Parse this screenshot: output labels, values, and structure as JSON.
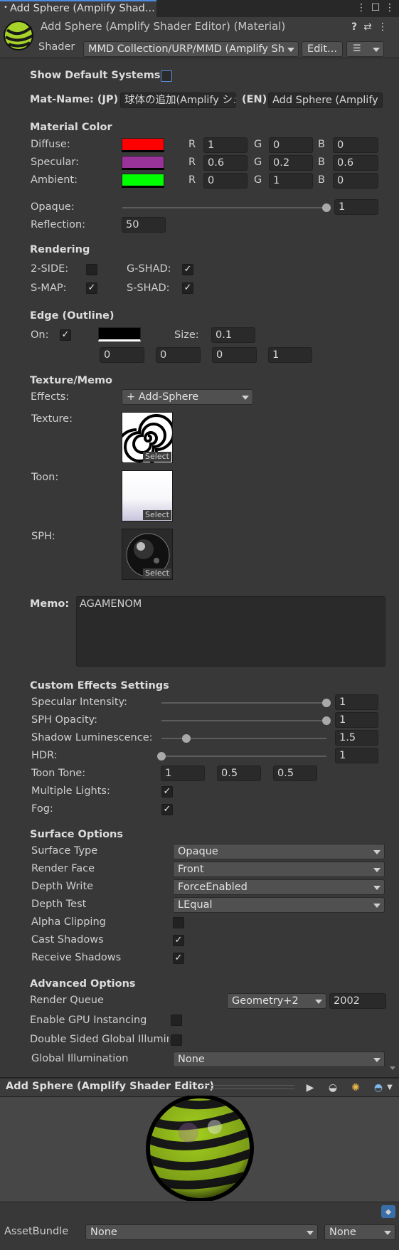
{
  "tab": {
    "title": "Add Sphere (Amplify Shad..."
  },
  "header": {
    "title": "Add Sphere (Amplify Shader Editor) (Material)",
    "shader_label": "Shader",
    "shader_value": "MMD Collection/URP/MMD (Amplify Sh",
    "edit_label": "Edit..."
  },
  "general": {
    "show_default_label": "Show Default Systems:",
    "matname_label": "Mat-Name: (JP)",
    "matname_jp": "球体の追加(Amplify シェ",
    "en_label": "(EN)",
    "matname_en": "Add Sphere (Amplify S"
  },
  "material_color": {
    "title": "Material Color",
    "rows": [
      {
        "label": "Diffuse:",
        "color": "#ff0000",
        "r": "1",
        "g": "0",
        "b": "0"
      },
      {
        "label": "Specular:",
        "color": "#993399",
        "r": "0.6",
        "g": "0.2",
        "b": "0.6"
      },
      {
        "label": "Ambient:",
        "color": "#00ff00",
        "r": "0",
        "g": "1",
        "b": "0"
      }
    ],
    "r_label": "R",
    "g_label": "G",
    "b_label": "B",
    "opaque_label": "Opaque:",
    "opaque_value": "1",
    "opaque_level": 1,
    "reflection_label": "Reflection:",
    "reflection_value": "50"
  },
  "rendering": {
    "title": "Rendering",
    "two_side": "2-SIDE:",
    "g_shad": "G-SHAD:",
    "s_map": "S-MAP:",
    "s_shad": "S-SHAD:",
    "two_side_on": false,
    "g_shad_on": true,
    "s_map_on": true,
    "s_shad_on": true
  },
  "edge": {
    "title": "Edge (Outline)",
    "on_label": "On:",
    "size_label": "Size:",
    "size_value": "0.1",
    "color": "#000000",
    "v0": "0",
    "v1": "0",
    "v2": "0",
    "v3": "1"
  },
  "texture": {
    "title": "Texture/Memo",
    "effects_label": "Effects:",
    "effects_value": "+ Add-Sphere",
    "texture_label": "Texture:",
    "toon_label": "Toon:",
    "sph_label": "SPH:",
    "select_label": "Select"
  },
  "memo": {
    "label": "Memo:",
    "value": "AGAMENOM"
  },
  "custom": {
    "title": "Custom Effects Settings",
    "spec_label": "Specular Intensity:",
    "spec_value": "1",
    "spec_level": 1,
    "sph_label": "SPH Opacity:",
    "sph_value": "1",
    "sph_level": 1,
    "shadow_label": "Shadow Luminescence:",
    "shadow_value": "1.5",
    "shadow_level": 0.15,
    "hdr_label": "HDR:",
    "hdr_value": "1",
    "hdr_level": 0,
    "toon_label": "Toon Tone:",
    "toon_values": [
      "1",
      "0.5",
      "0.5"
    ],
    "multi_label": "Multiple Lights:",
    "fog_label": "Fog:"
  },
  "surface": {
    "title": "Surface Options",
    "type_label": "Surface Type",
    "type_value": "Opaque",
    "face_label": "Render Face",
    "face_value": "Front",
    "dw_label": "Depth Write",
    "dw_value": "ForceEnabled",
    "dt_label": "Depth Test",
    "dt_value": "LEqual",
    "alpha_label": "Alpha Clipping",
    "cast_label": "Cast Shadows",
    "recv_label": "Receive Shadows"
  },
  "advanced": {
    "title": "Advanced Options",
    "queue_label": "Render Queue",
    "queue_value": "Geometry+2",
    "queue_number": "2002",
    "gpu_label": "Enable GPU Instancing",
    "dsgi_label": "Double Sided Global Illumin",
    "gi_label": "Global Illumination",
    "gi_value": "None"
  },
  "preview": {
    "title": "Add Sphere (Amplify Shader Editor)"
  },
  "assetbundle": {
    "label": "AssetBundle",
    "value": "None",
    "variant": "None"
  },
  "colors": {
    "accent": "#4d8ae0",
    "panel": "#383838",
    "field": "#2a2a2a"
  }
}
